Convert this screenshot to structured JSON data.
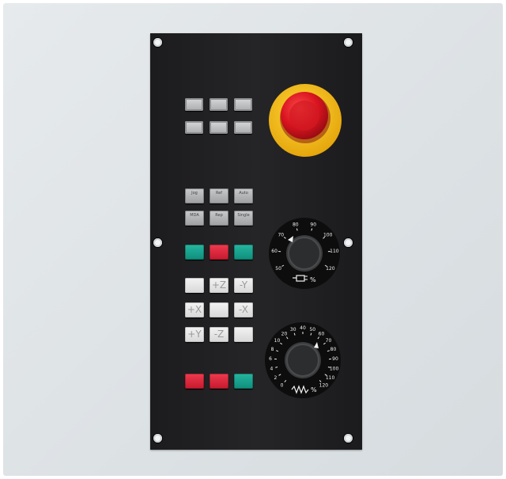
{
  "panel": {
    "override_dials": {
      "feed": {
        "scale": [
          "50",
          "60",
          "70",
          "80",
          "90",
          "100",
          "110",
          "120"
        ],
        "unit_label": "%"
      },
      "spindle": {
        "scale": [
          "0",
          "2",
          "4",
          "6",
          "8",
          "10",
          "20",
          "30",
          "40",
          "50",
          "60",
          "70",
          "80",
          "90",
          "100",
          "110",
          "120"
        ],
        "unit_label": "%"
      }
    },
    "keys": {
      "plus_z": "+Z",
      "minus_y": "-Y",
      "plus_x": "+X",
      "minus_x": "-X",
      "plus_y": "+Y",
      "minus_z": "-Z",
      "fn_labels": [
        "Jog",
        "Ref",
        "Auto",
        "MDA",
        "Rep",
        "Single"
      ]
    },
    "colors": {
      "panel": "#222224",
      "teal": "#1aa38e",
      "red": "#d92238",
      "estop_ring": "#f3c21a",
      "estop_button": "#d8141f"
    }
  }
}
